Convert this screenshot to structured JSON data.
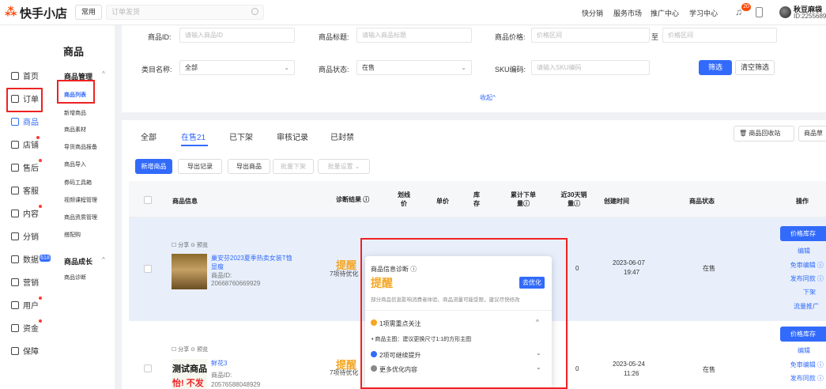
{
  "topbar": {
    "logo": "快手小店",
    "tab_common": "常用",
    "search_placeholder": "订单发货",
    "nav": [
      "快分销",
      "服务市场",
      "推广中心",
      "学习中心"
    ],
    "bell_badge": "20",
    "user_name": "秋豆麻袋",
    "user_id": "ID:2255689"
  },
  "sidebar": {
    "items": [
      "首页",
      "订单",
      "商品",
      "店铺",
      "售后",
      "客服",
      "内容",
      "分销",
      "数据",
      "营销",
      "用户",
      "资金",
      "保障"
    ],
    "marketing_badge": "618"
  },
  "subnav": {
    "title": "商品",
    "group1": "商品管理",
    "group1_items": [
      "商品列表",
      "新增商品",
      "商品素材",
      "导货商品报备",
      "商品导入",
      "券码工具箱",
      "视频课程管理",
      "商品资质管理",
      "搭配购"
    ],
    "group2": "商品成长",
    "group2_items": [
      "商品诊断"
    ]
  },
  "filters": {
    "id_label": "商品ID:",
    "id_ph": "请输入商品ID",
    "title_label": "商品标题:",
    "title_ph": "请输入商品标题",
    "price_label": "商品价格:",
    "price_ph": "价格区间",
    "to": "至",
    "price_ph2": "价格区间",
    "cat_label": "类目名称:",
    "cat_value": "全部",
    "state_label": "商品状态:",
    "state_value": "在售",
    "sku_label": "SKU编码:",
    "sku_ph": "请输入SKU编码",
    "filter_btn": "筛选",
    "clear_btn": "清空筛选",
    "collapse": "收起^"
  },
  "tabs": [
    "全部",
    "在售21",
    "已下架",
    "审核记录",
    "已封禁"
  ],
  "toolbar": {
    "recycle": "商品回收站",
    "more": "商品草",
    "buttons": [
      "新增商品",
      "导出记录",
      "导出商品",
      "批量下架",
      "批量设置 ⌄"
    ]
  },
  "table": {
    "headers": [
      "商品信息",
      "诊断结果 ⓘ",
      "划线价",
      "单价",
      "库存",
      "累计下单量ⓘ",
      "近30天销量ⓘ",
      "创建时间",
      "商品状态",
      "操作"
    ],
    "rows": [
      {
        "share": "☐ 分享  ⊙ 预览",
        "name": "巢安芬2023夏季热卖女装T恤显瘦",
        "id_label": "商品ID:",
        "id": "20668760669929",
        "diag": "提醒",
        "diag_sub": "7项待优化",
        "sales30": "0",
        "created": "2023-06-07",
        "created_time": "19:47",
        "status": "在售",
        "ops": [
          "价格库存",
          "编辑",
          "免审编辑 ⓘ",
          "发布同款 ⓘ",
          "下架",
          "流量推广"
        ]
      },
      {
        "share": "☐ 分享  ⊙ 预览",
        "name": "鲜花3",
        "thumb_text": "测试商品",
        "thumb_text2": "怡! 不发",
        "id_label": "商品ID:",
        "id": "20576588048929",
        "diag": "提醒",
        "diag_sub": "7项待优化",
        "sales30": "0",
        "created": "2023-05-24",
        "created_time": "11:26",
        "status": "在售",
        "ops": [
          "价格库存",
          "编辑",
          "免审编辑 ⓘ",
          "发布同款 ⓘ"
        ]
      }
    ]
  },
  "popover": {
    "title": "商品信息诊断 ⓘ",
    "level": "提醒",
    "go": "去优化",
    "desc": "部分商品信息影响消费者体验、商品流量可能受限，建议尽快修改",
    "need_focus": "1项需重点关注",
    "focus_item": "• 商品主图：建议更换尺寸1:1的方形主图",
    "can_improve": "2项可继续提升",
    "more": "更多优化内容"
  }
}
